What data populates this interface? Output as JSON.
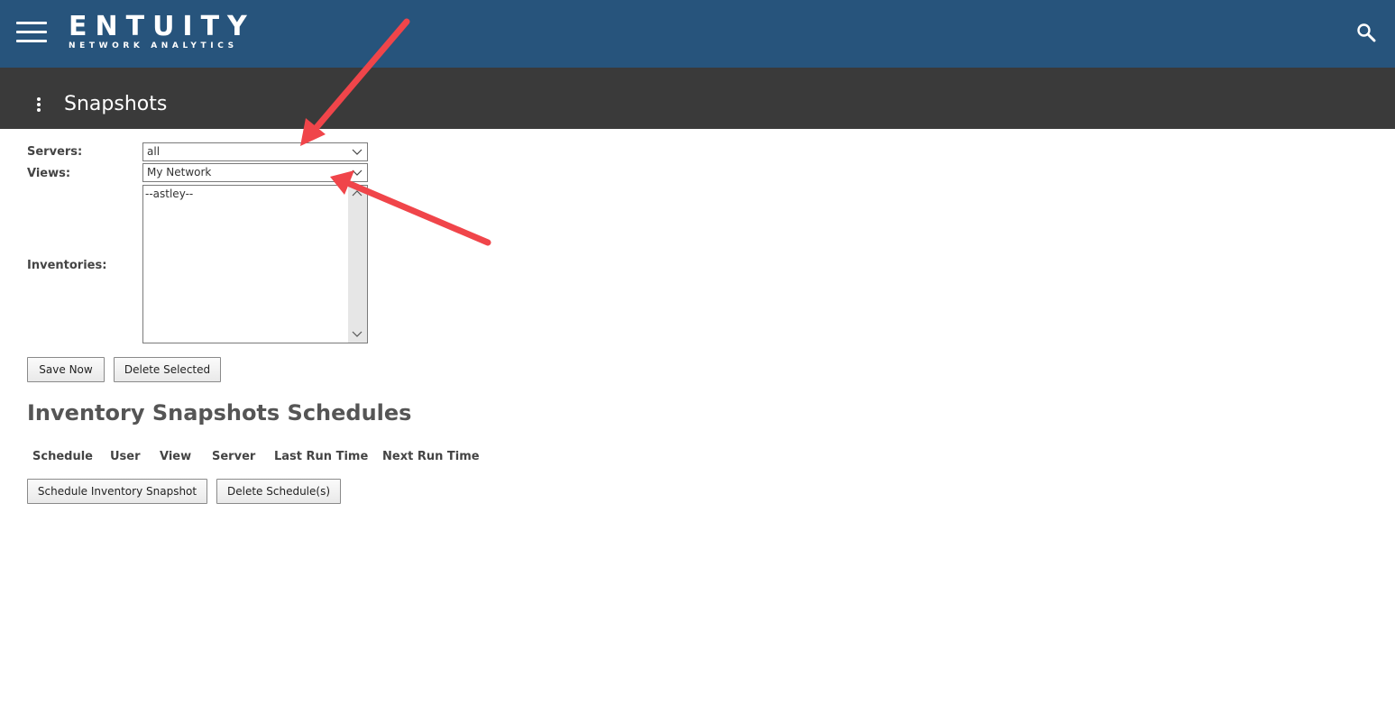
{
  "header": {
    "brand": "ENTUITY",
    "brand_sub": "NETWORK ANALYTICS",
    "menu_icon": "hamburger-menu-icon",
    "search_icon": "search-icon",
    "bg_color": "#27547c"
  },
  "titlebar": {
    "title": "Snapshots",
    "options_icon": "kebab-menu-icon",
    "bg_color": "#3a3a3a"
  },
  "form": {
    "servers_label": "Servers:",
    "servers_value": "all",
    "views_label": "Views:",
    "views_value": "My Network",
    "inventories_label": "Inventories:",
    "inventories_items": [
      "--astley--"
    ]
  },
  "actions": {
    "save_now": "Save Now",
    "delete_selected": "Delete Selected"
  },
  "schedules": {
    "title": "Inventory Snapshots Schedules",
    "columns": [
      "Schedule",
      "User",
      "View",
      "Server",
      "Last Run Time",
      "Next Run Time"
    ],
    "schedule_button": "Schedule Inventory Snapshot",
    "delete_button": "Delete Schedule(s)"
  },
  "annotations": {
    "arrow_color": "#f0454a"
  }
}
